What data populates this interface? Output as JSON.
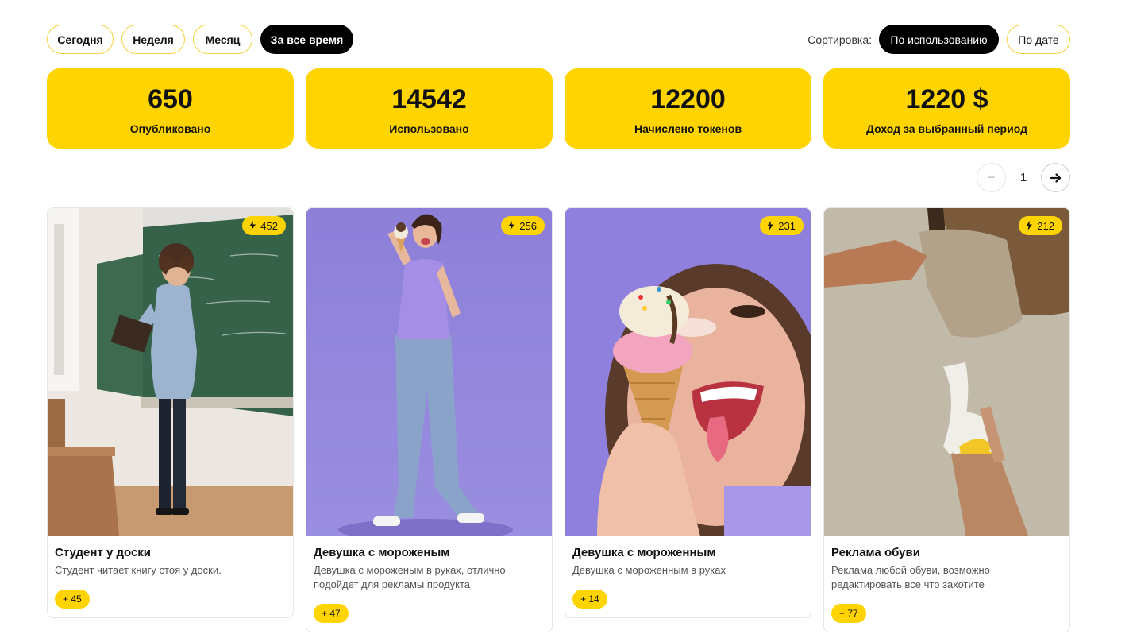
{
  "periods": [
    {
      "label": "Сегодня",
      "active": false
    },
    {
      "label": "Неделя",
      "active": false
    },
    {
      "label": "Месяц",
      "active": false
    },
    {
      "label": "За все время",
      "active": true
    }
  ],
  "sort": {
    "label": "Сортировка:",
    "options": [
      {
        "label": "По использованию",
        "active": true
      },
      {
        "label": "По дате",
        "active": false
      }
    ]
  },
  "stats": [
    {
      "value": "650",
      "label": "Опубликовано"
    },
    {
      "value": "14542",
      "label": "Использовано"
    },
    {
      "value": "12200",
      "label": "Начислено токенов"
    },
    {
      "value": "1220 $",
      "label": "Доход за выбранный период"
    }
  ],
  "pagination": {
    "prev_symbol": "−",
    "current": "1",
    "next_icon": "arrow-right-icon"
  },
  "cards": [
    {
      "title": "Студент у доски",
      "description": "Студент читает книгу стоя у доски.",
      "uses": "452",
      "reward": "+ 45"
    },
    {
      "title": "Девушка с мороженым",
      "description": "Девушка с мороженым в руках, отлично подойдет для рекламы продукта",
      "uses": "256",
      "reward": "+ 47"
    },
    {
      "title": "Девушка с мороженным",
      "description": "Девушка с мороженным в руках",
      "uses": "231",
      "reward": "+ 14"
    },
    {
      "title": "Реклама обуви",
      "description": "Реклама любой обуви, возможно редактировать все что захотите",
      "uses": "212",
      "reward": "+ 77"
    }
  ],
  "colors": {
    "accent": "#ffd400",
    "dark": "#000000",
    "border": "#f3d43f"
  }
}
